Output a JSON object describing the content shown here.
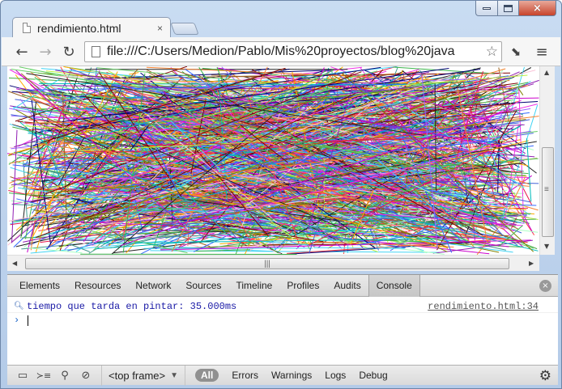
{
  "window": {
    "tab_title": "rendimiento.html",
    "tab_close": "×",
    "caption": {
      "minimize": "minimize-icon",
      "maximize": "maximize-icon",
      "close": "×"
    }
  },
  "toolbar": {
    "back": "←",
    "forward": "→",
    "reload": "↻",
    "url": "file:///C:/Users/Medion/Pablo/Mis%20proyectos/blog%20java",
    "star": "☆",
    "extension": "⬊",
    "menu": "≡"
  },
  "scrollbars": {
    "h_grip": "|||",
    "left": "◀",
    "right": "▶",
    "up": "▲",
    "down": "▼",
    "v_grip": "≡"
  },
  "devtools": {
    "tabs": [
      "Elements",
      "Resources",
      "Network",
      "Sources",
      "Timeline",
      "Profiles",
      "Audits",
      "Console"
    ],
    "active_tab": "Console",
    "close": "×",
    "log": {
      "icon": "magnifier-icon",
      "message": "tiempo que tarda en pintar: 35.000ms",
      "source": "rendimiento.html:34"
    },
    "prompt": "›",
    "status": {
      "dock": "▭",
      "drawer": "≻≡",
      "search": "⚲",
      "clear": "⊘",
      "frame": "<top frame>",
      "frame_dd": "▼",
      "filters": [
        "All",
        "Errors",
        "Warnings",
        "Logs",
        "Debug"
      ],
      "settings": "⚙"
    }
  },
  "canvas": {
    "palette": [
      "#e6194b",
      "#3cb44b",
      "#4363d8",
      "#f58231",
      "#911eb4",
      "#42d4f4",
      "#f032e6",
      "#bfef45",
      "#fabed4",
      "#469990",
      "#9a6324",
      "#800000",
      "#aaffc3",
      "#808000",
      "#000075",
      "#222222",
      "#ff4444",
      "#44aa44",
      "#3366ff",
      "#cc00cc",
      "#00bbbb",
      "#ffaa00",
      "#66cc66",
      "#9966ff"
    ]
  }
}
